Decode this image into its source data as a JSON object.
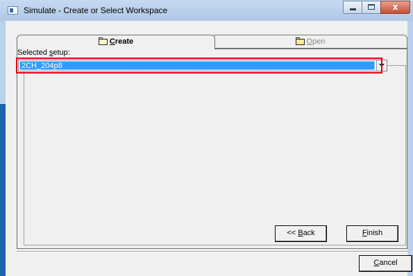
{
  "window": {
    "title": "Simulate - Create or Select Workspace",
    "controls": {
      "minimize": "minimize",
      "maximize": "maximize",
      "close": "x"
    }
  },
  "tabs": [
    {
      "prefix": "",
      "mnemonic": "C",
      "rest": "reate",
      "icon": "folder-icon",
      "selected": true
    },
    {
      "prefix": "",
      "mnemonic": "O",
      "rest": "pen",
      "icon": "open-folder-icon",
      "selected": false
    }
  ],
  "create_panel": {
    "setup_label": {
      "prefix": "Selected ",
      "mnemonic": "s",
      "rest": "etup:"
    },
    "setup_combo": {
      "selected_value": "2CH_204p8"
    }
  },
  "buttons": {
    "back": {
      "prefix": "<< ",
      "mnemonic": "B",
      "rest": "ack"
    },
    "finish": {
      "prefix": "",
      "mnemonic": "F",
      "rest": "inish"
    },
    "cancel": {
      "prefix": "",
      "mnemonic": "C",
      "rest": "ancel"
    }
  },
  "colors": {
    "selection": "#3399ff",
    "highlight_box": "#e0001b",
    "dialog_background": "#f0f0f0"
  }
}
